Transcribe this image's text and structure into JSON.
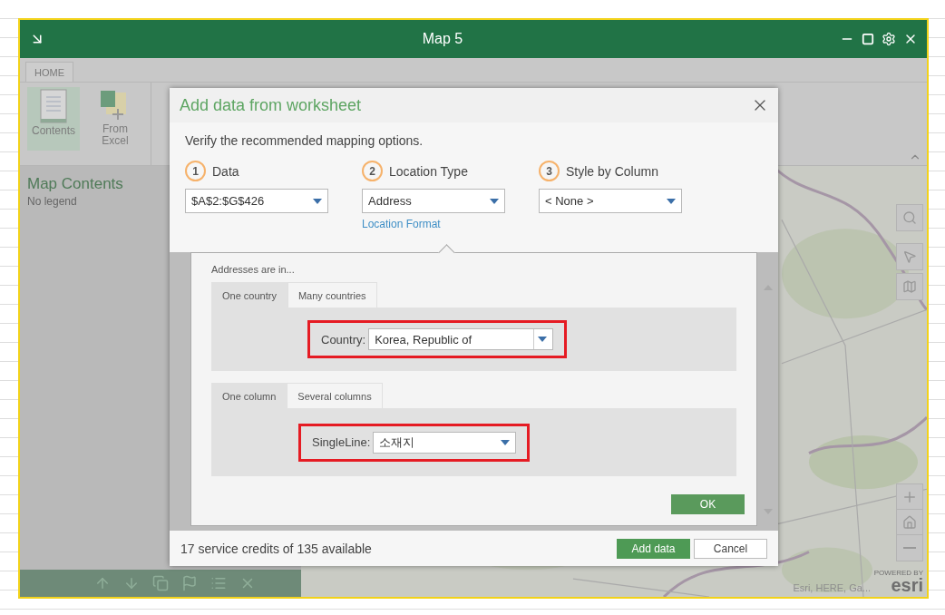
{
  "window": {
    "title": "Map 5"
  },
  "ribbon": {
    "tabs": [
      {
        "label": "HOME",
        "selected": true
      }
    ],
    "buttons": [
      {
        "label": "Contents",
        "kind": "contents",
        "selected": true
      },
      {
        "label": "From Excel",
        "kind": "excel",
        "selected": false
      }
    ]
  },
  "sidebar": {
    "title": "Map Contents",
    "empty_text": "No legend"
  },
  "map": {
    "attribution": "Esri, HERE, Ga...",
    "logo": "esri",
    "logo_caption": "POWERED BY"
  },
  "dialog": {
    "title": "Add data from worksheet",
    "instructions": "Verify the recommended mapping options.",
    "steps": [
      {
        "number": "1",
        "label": "Data",
        "value": "$A$2:$G$426"
      },
      {
        "number": "2",
        "label": "Location Type",
        "value": "Address",
        "link": "Location Format"
      },
      {
        "number": "3",
        "label": "Style by Column",
        "value": "< None >"
      }
    ],
    "location_format": {
      "heading": "Addresses are in...",
      "groups": [
        {
          "tabs": [
            {
              "label": "One country",
              "selected": true
            },
            {
              "label": "Many countries",
              "selected": false
            }
          ],
          "field": {
            "label": "Country:",
            "value": "Korea, Republic of",
            "kind": "split",
            "highlighted": true
          }
        },
        {
          "tabs": [
            {
              "label": "One column",
              "selected": true
            },
            {
              "label": "Several columns",
              "selected": false
            }
          ],
          "field": {
            "label": "SingleLine:",
            "value": "소재지",
            "kind": "plain",
            "highlighted": true
          }
        }
      ],
      "ok_button": "OK"
    },
    "credits": "17 service credits of 135 available",
    "buttons": [
      {
        "label": "Add data",
        "kind": "primary"
      },
      {
        "label": "Cancel",
        "kind": "secondary"
      }
    ]
  }
}
